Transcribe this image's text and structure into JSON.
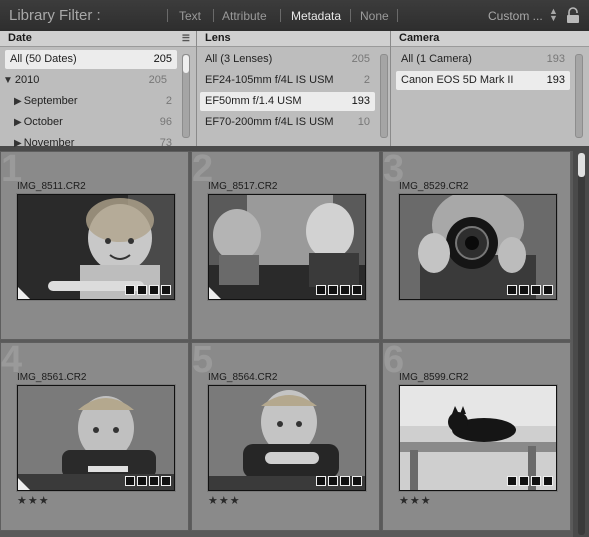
{
  "filterbar": {
    "title": "Library Filter :",
    "tabs": [
      "Text",
      "Attribute",
      "Metadata",
      "None"
    ],
    "active_tab": "Metadata",
    "preset": "Custom ..."
  },
  "columns": [
    {
      "header": "Date",
      "rows": [
        {
          "label": "All (50 Dates)",
          "count": "205",
          "selected": true
        },
        {
          "label": "2010",
          "count": "205",
          "expander": "expanded"
        },
        {
          "label": "September",
          "count": "2",
          "expander": "collapsed"
        },
        {
          "label": "October",
          "count": "96",
          "expander": "collapsed"
        },
        {
          "label": "November",
          "count": "73",
          "expander": "collapsed"
        }
      ]
    },
    {
      "header": "Lens",
      "rows": [
        {
          "label": "All (3 Lenses)",
          "count": "205"
        },
        {
          "label": "EF24-105mm f/4L IS USM",
          "count": "2"
        },
        {
          "label": "EF50mm f/1.4 USM",
          "count": "193",
          "selected": true
        },
        {
          "label": "EF70-200mm f/4L IS USM",
          "count": "10"
        }
      ]
    },
    {
      "header": "Camera",
      "rows": [
        {
          "label": "All (1 Camera)",
          "count": "193"
        },
        {
          "label": "Canon EOS 5D Mark II",
          "count": "193",
          "selected": true
        }
      ]
    }
  ],
  "grid": [
    {
      "index": "1",
      "filename": "IMG_8511.CR2",
      "stars": ""
    },
    {
      "index": "2",
      "filename": "IMG_8517.CR2",
      "stars": ""
    },
    {
      "index": "3",
      "filename": "IMG_8529.CR2",
      "stars": ""
    },
    {
      "index": "4",
      "filename": "IMG_8561.CR2",
      "stars": "★★★"
    },
    {
      "index": "5",
      "filename": "IMG_8564.CR2",
      "stars": "★★★"
    },
    {
      "index": "6",
      "filename": "IMG_8599.CR2",
      "stars": "★★★"
    }
  ],
  "icons": {
    "lock": "lock-icon",
    "sort": "sort-icon",
    "expanded": "triangle-down-icon",
    "collapsed": "triangle-right-icon"
  }
}
